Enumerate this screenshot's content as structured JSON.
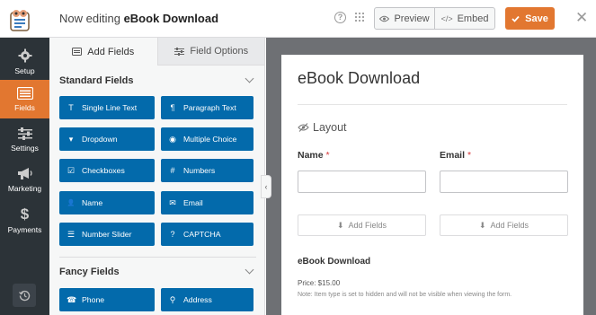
{
  "header": {
    "title_prefix": "Now editing",
    "title_form": "eBook Download",
    "preview_label": "Preview",
    "embed_label": "Embed",
    "save_label": "Save",
    "close_glyph": "✕"
  },
  "nav": {
    "items": [
      {
        "label": "Setup",
        "icon": "gear-icon"
      },
      {
        "label": "Fields",
        "icon": "fields-list-icon"
      },
      {
        "label": "Settings",
        "icon": "sliders-icon"
      },
      {
        "label": "Marketing",
        "icon": "megaphone-icon"
      },
      {
        "label": "Payments",
        "icon": "dollar-icon"
      }
    ],
    "active": "Fields"
  },
  "panel": {
    "tabs": [
      "Add Fields",
      "Field Options"
    ],
    "standard_title": "Standard Fields",
    "standard_fields": [
      {
        "label": "Single Line Text",
        "icon": "T"
      },
      {
        "label": "Paragraph Text",
        "icon": "¶"
      },
      {
        "label": "Dropdown",
        "icon": "▾"
      },
      {
        "label": "Multiple Choice",
        "icon": "◉"
      },
      {
        "label": "Checkboxes",
        "icon": "☑"
      },
      {
        "label": "Numbers",
        "icon": "#"
      },
      {
        "label": "Name",
        "icon": "👤"
      },
      {
        "label": "Email",
        "icon": "✉"
      },
      {
        "label": "Number Slider",
        "icon": "☰"
      },
      {
        "label": "CAPTCHA",
        "icon": "?"
      }
    ],
    "fancy_title": "Fancy Fields",
    "fancy_fields": [
      {
        "label": "Phone",
        "icon": "☎"
      },
      {
        "label": "Address",
        "icon": "⚲"
      }
    ]
  },
  "form": {
    "title": "eBook Download",
    "layout_label": "Layout",
    "name_label": "Name",
    "email_label": "Email",
    "required_mark": "*",
    "add_fields_label": "Add Fields",
    "ebook_label": "eBook Download",
    "price_text": "Price: $15.00",
    "note_text": "Note: Item type is set to hidden and will not be visible when viewing the form."
  },
  "colors": {
    "accent": "#e27730",
    "field_button": "#036aab",
    "nav_bg": "#2c3338",
    "canvas_bg": "#6e7074"
  }
}
